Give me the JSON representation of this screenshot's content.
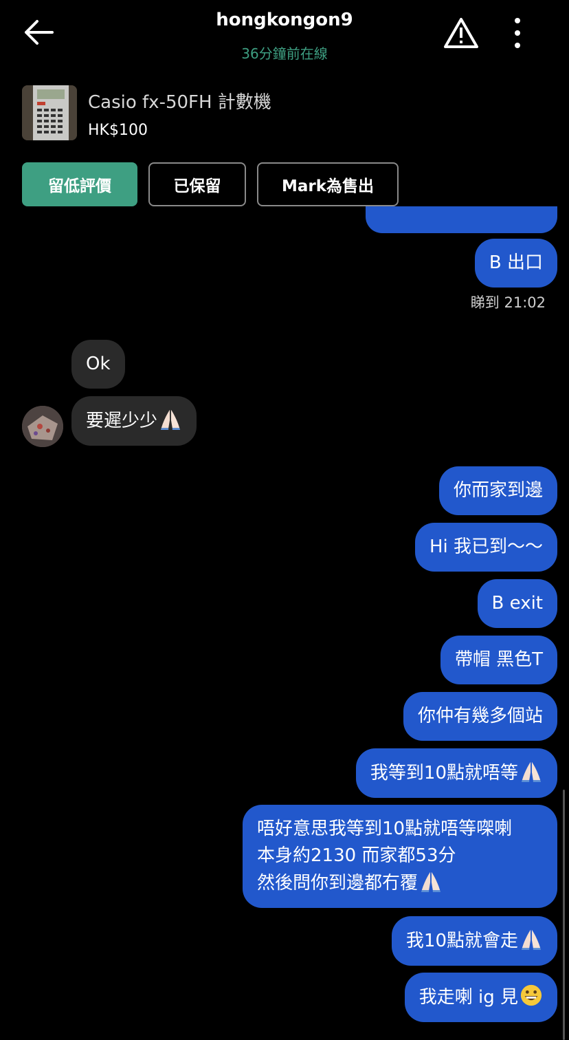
{
  "header": {
    "username": "hongkongon9",
    "status": "36分鐘前在線"
  },
  "listing": {
    "name": "Casio fx-50FH 計數機",
    "price": "HK$100"
  },
  "actions": {
    "review_label": "留低評價",
    "reserved_label": "已保留",
    "mark_sold_label": "Mark為售出"
  },
  "chat": {
    "read_receipt": "睇到 21:02",
    "messages": [
      {
        "from": "me",
        "text": "B 出口"
      },
      {
        "from": "them",
        "text": "Ok"
      },
      {
        "from": "them",
        "text": "要遲少少",
        "emoji": "folded-hands"
      },
      {
        "from": "me",
        "text": "你而家到邊"
      },
      {
        "from": "me",
        "text": "Hi 我已到～～"
      },
      {
        "from": "me",
        "text": "B exit"
      },
      {
        "from": "me",
        "text": "帶帽 黑色T"
      },
      {
        "from": "me",
        "text": "你仲有幾多個站"
      },
      {
        "from": "me",
        "text": "我等到10點就唔等",
        "emoji": "folded-hands"
      },
      {
        "from": "me",
        "lines": [
          "唔好意思我等到10點就唔等㗎喇",
          "本身約2130 而家都53分",
          "然後問你到邊都冇覆"
        ],
        "emoji": "folded-hands"
      },
      {
        "from": "me",
        "text": "我10點就會走",
        "emoji": "folded-hands"
      },
      {
        "from": "me",
        "text": "我走喇 ig 見",
        "emoji": "grinning-face"
      }
    ]
  },
  "colors": {
    "background": "#000000",
    "outgoing_bubble": "#2258cc",
    "incoming_bubble": "#2a2a2a",
    "accent_green": "#3e9f82"
  }
}
